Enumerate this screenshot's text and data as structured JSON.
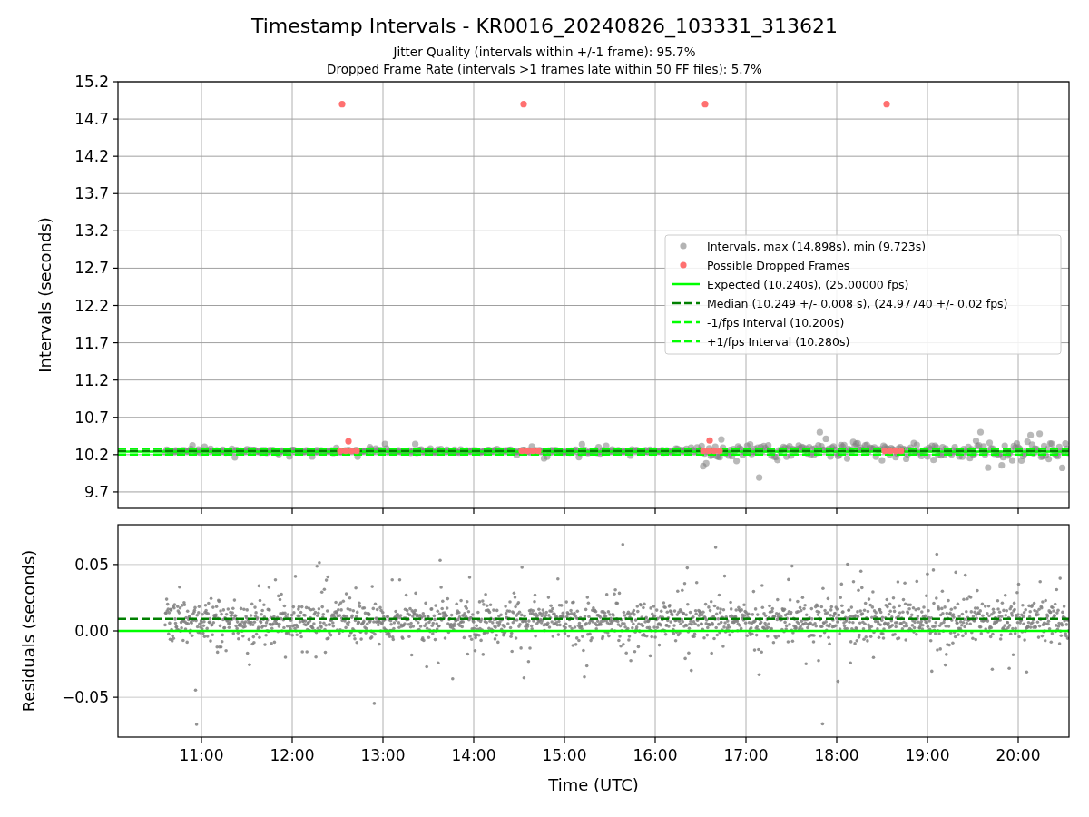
{
  "figure": {
    "title": "Timestamp Intervals - KR0016_20240826_103331_313621",
    "subtitles": [
      "Jitter Quality (intervals within +/-1 frame): 95.7%",
      "Dropped Frame Rate (intervals >1 frames late within 50 FF files): 5.7%"
    ]
  },
  "charts": [
    {
      "chart_data": {
        "type": "scatter",
        "ylabel": "Intervals (seconds)",
        "grid": true,
        "legend": true,
        "xlim": [
          10.08,
          20.56
        ],
        "ylim": [
          9.48,
          15.2
        ],
        "yticks": [
          {
            "value": 9.7,
            "label": "9.7"
          },
          {
            "value": 10.2,
            "label": "10.2"
          },
          {
            "value": 10.7,
            "label": "10.7"
          },
          {
            "value": 11.2,
            "label": "11.2"
          },
          {
            "value": 11.7,
            "label": "11.7"
          },
          {
            "value": 12.2,
            "label": "12.2"
          },
          {
            "value": 12.7,
            "label": "12.7"
          },
          {
            "value": 13.2,
            "label": "13.2"
          },
          {
            "value": 13.7,
            "label": "13.7"
          },
          {
            "value": 14.2,
            "label": "14.2"
          },
          {
            "value": 14.7,
            "label": "14.7"
          },
          {
            "value": 15.2,
            "label": "15.2"
          }
        ],
        "series": [
          {
            "name": "Intervals, max (14.898s), min (9.723s)",
            "color": "#b3b3b3"
          },
          {
            "name": "Possible Dropped Frames",
            "color": "#ff7070",
            "x": [
              12.53,
              12.59,
              12.65,
              12.71,
              12.62,
              14.53,
              14.59,
              14.65,
              14.71,
              16.53,
              16.59,
              16.65,
              16.71,
              16.6,
              18.53,
              18.59,
              18.65,
              18.71,
              12.55,
              14.55,
              16.55,
              18.55
            ],
            "values": [
              10.25,
              10.25,
              10.25,
              10.25,
              10.38,
              10.25,
              10.25,
              10.25,
              10.25,
              10.25,
              10.25,
              10.25,
              10.25,
              10.39,
              10.25,
              10.25,
              10.25,
              10.25,
              14.9,
              14.9,
              14.9,
              14.9
            ]
          }
        ],
        "ref_lines": [
          {
            "axis": "y",
            "value": 10.24,
            "label": "Expected (10.240s), (25.00000 fps)",
            "color": "#00ff00"
          },
          {
            "axis": "y",
            "value": 10.249,
            "label": "Median (10.249 +/- 0.008 s), (24.97740 +/- 0.02 fps)",
            "color": "#008000"
          },
          {
            "axis": "y",
            "value": 10.2,
            "label": "-1/fps Interval (10.200s)",
            "color": "#00ff00"
          },
          {
            "axis": "y",
            "value": 10.28,
            "label": "+1/fps Interval (10.280s)",
            "color": "#00ff00"
          }
        ]
      }
    },
    {
      "chart_data": {
        "type": "scatter",
        "xlabel": "Time (UTC)",
        "ylabel": "Residuals (seconds)",
        "grid": true,
        "xlim": [
          10.08,
          20.56
        ],
        "ylim": [
          -0.08,
          0.08
        ],
        "xticks": [
          {
            "value": 11,
            "label": "11:00"
          },
          {
            "value": 12,
            "label": "12:00"
          },
          {
            "value": 13,
            "label": "13:00"
          },
          {
            "value": 14,
            "label": "14:00"
          },
          {
            "value": 15,
            "label": "15:00"
          },
          {
            "value": 16,
            "label": "16:00"
          },
          {
            "value": 17,
            "label": "17:00"
          },
          {
            "value": 18,
            "label": "18:00"
          },
          {
            "value": 19,
            "label": "19:00"
          },
          {
            "value": 20,
            "label": "20:00"
          }
        ],
        "yticks": [
          {
            "value": 0.05,
            "label": "0.05"
          },
          {
            "value": 0,
            "label": "0.00"
          },
          {
            "value": -0.05,
            "label": "−0.05"
          }
        ],
        "ref_lines": [
          {
            "axis": "y",
            "value": 0,
            "color": "#00ff00"
          },
          {
            "axis": "y",
            "value": 0.009,
            "color": "#008000"
          }
        ]
      }
    }
  ]
}
